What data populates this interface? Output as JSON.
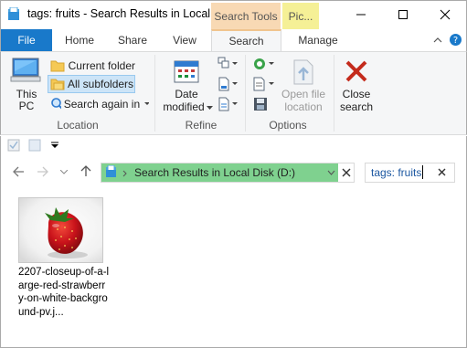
{
  "window": {
    "title": "tags: fruits - Search Results in Local ...",
    "context_tab_search_tools": "Search Tools",
    "context_tab_picture": "Pic..."
  },
  "tabs": {
    "file": "File",
    "home": "Home",
    "share": "Share",
    "view": "View",
    "search": "Search",
    "manage": "Manage"
  },
  "ribbon": {
    "location": {
      "this_pc": "This PC",
      "current_folder": "Current folder",
      "all_subfolders": "All subfolders",
      "search_again_in": "Search again in",
      "group_label": "Location"
    },
    "refine": {
      "date_modified_line1": "Date",
      "date_modified_line2": "modified",
      "group_label": "Refine"
    },
    "options": {
      "open_file_location_line1": "Open file",
      "open_file_location_line2": "location",
      "group_label": "Options"
    },
    "close_search_line1": "Close",
    "close_search_line2": "search"
  },
  "address": {
    "path": "Search Results in Local Disk (D:)",
    "search_query": "tags: fruits"
  },
  "files": [
    {
      "name": "2207-closeup-of-a-large-red-strawberry-on-white-background-pv.j..."
    }
  ]
}
